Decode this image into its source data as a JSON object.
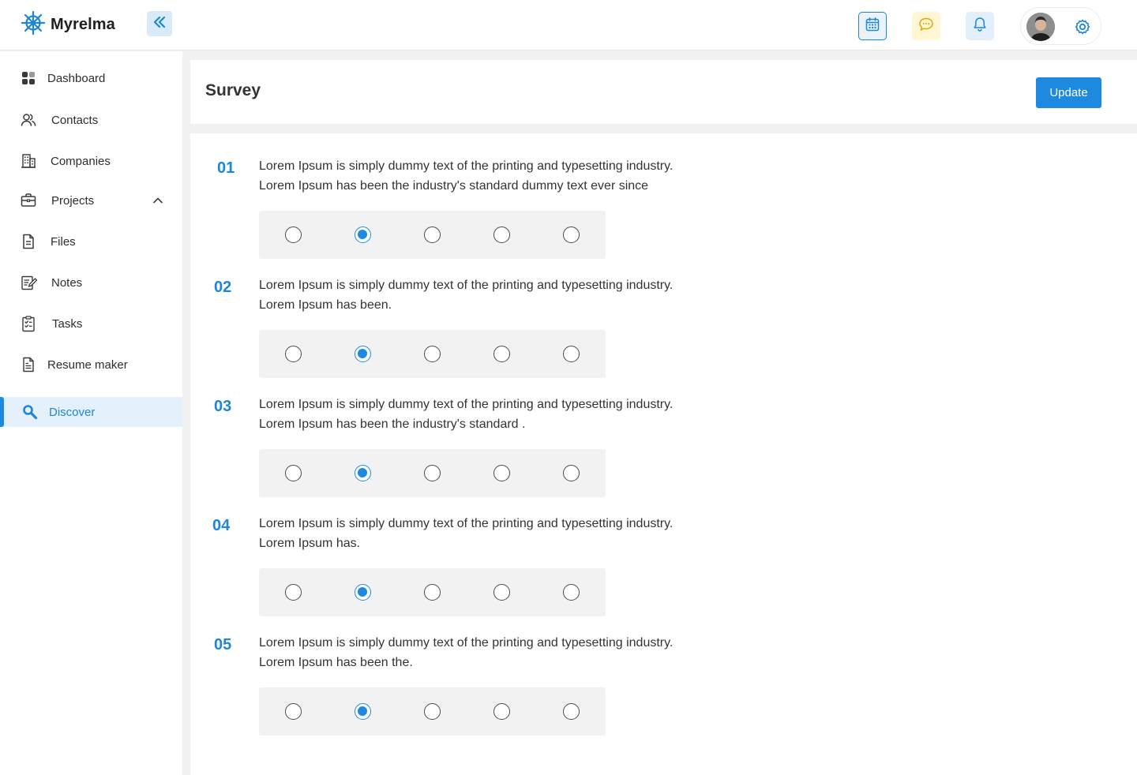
{
  "app": {
    "name": "Myrelma"
  },
  "sidebar": {
    "items": [
      {
        "label": "Dashboard",
        "icon": "dashboard-icon"
      },
      {
        "label": "Contacts",
        "icon": "contacts-icon"
      },
      {
        "label": "Companies",
        "icon": "companies-icon"
      },
      {
        "label": "Projects",
        "icon": "briefcase-icon"
      },
      {
        "label": "Files",
        "icon": "file-icon"
      },
      {
        "label": "Notes",
        "icon": "notes-icon"
      },
      {
        "label": "Tasks",
        "icon": "tasks-icon"
      },
      {
        "label": "Resume maker",
        "icon": "resume-icon"
      },
      {
        "label": "Discover",
        "icon": "discover-search-icon",
        "active": true
      }
    ]
  },
  "page": {
    "title": "Survey",
    "update_label": "Update"
  },
  "colors": {
    "accent": "#1d8ae0",
    "accent_light": "#e4f0fb",
    "chat_bg": "#fff6d4",
    "options_bg": "#f2f2f2"
  },
  "survey": {
    "questions": [
      {
        "number": "01",
        "line1": "Lorem Ipsum is simply dummy text of the printing and typesetting industry.",
        "line2": "Lorem Ipsum has been the industry's standard dummy text ever since",
        "selected_option": 2,
        "option_count": 5
      },
      {
        "number": "02",
        "line1": "Lorem Ipsum is simply dummy text of the printing and typesetting industry.",
        "line2": "Lorem Ipsum has been.",
        "selected_option": 2,
        "option_count": 5
      },
      {
        "number": "03",
        "line1": "Lorem Ipsum is simply dummy text of the printing and typesetting industry.",
        "line2": "Lorem Ipsum has been the industry's standard .",
        "selected_option": 2,
        "option_count": 5
      },
      {
        "number": "04",
        "line1": "Lorem Ipsum is simply dummy text of the printing and typesetting industry.",
        "line2": "Lorem Ipsum has.",
        "selected_option": 2,
        "option_count": 5
      },
      {
        "number": "05",
        "line1": "Lorem Ipsum is simply dummy text of the printing and typesetting industry.",
        "line2": "Lorem Ipsum has been the.",
        "selected_option": 2,
        "option_count": 5
      }
    ]
  }
}
